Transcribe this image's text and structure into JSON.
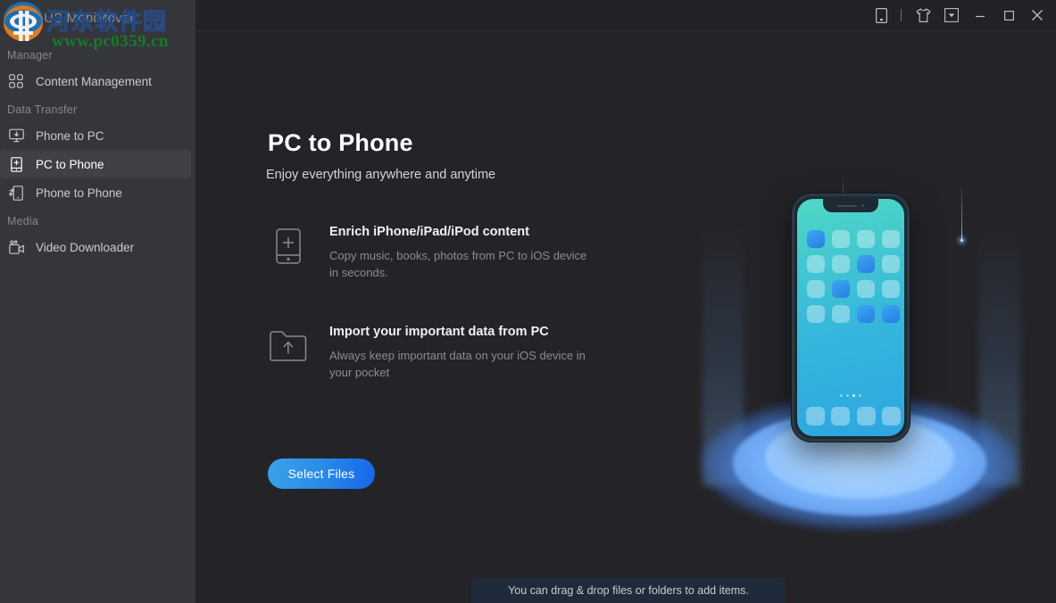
{
  "window": {
    "brand": "EaseUS MobiMover",
    "controls": [
      {
        "name": "device-icon",
        "label": "Device"
      },
      {
        "name": "tshirt-icon",
        "label": "Theme"
      },
      {
        "name": "menu-dropdown-icon",
        "label": "Menu"
      },
      {
        "name": "minimize-icon",
        "label": "Minimize"
      },
      {
        "name": "maximize-icon",
        "label": "Maximize"
      },
      {
        "name": "close-icon",
        "label": "Close"
      }
    ]
  },
  "watermark": {
    "chinese": "河东软件园",
    "url": "www.pc0359.cn"
  },
  "sidebar": {
    "sections": [
      {
        "label": "Manager",
        "items": [
          {
            "label": "Content Management",
            "icon": "grid-icon",
            "active": false
          }
        ]
      },
      {
        "label": "Data Transfer",
        "items": [
          {
            "label": "Phone to PC",
            "icon": "monitor-download-icon",
            "active": false
          },
          {
            "label": "PC to Phone",
            "icon": "phone-plus-icon",
            "active": true
          },
          {
            "label": "Phone to Phone",
            "icon": "phone-transfer-icon",
            "active": false
          }
        ]
      },
      {
        "label": "Media",
        "items": [
          {
            "label": "Video Downloader",
            "icon": "video-camera-icon",
            "active": false
          }
        ]
      }
    ]
  },
  "main": {
    "title": "PC to Phone",
    "subtitle": "Enjoy everything anywhere and anytime",
    "features": [
      {
        "icon": "phone-plus-icon",
        "title": "Enrich iPhone/iPad/iPod content",
        "desc": "Copy music, books, photos from PC to iOS device in seconds."
      },
      {
        "icon": "folder-upload-icon",
        "title": "Import your important data from PC",
        "desc": "Always keep important data on your iOS device in your pocket"
      }
    ],
    "select_files_label": "Select Files",
    "drop_hint": "You can drag & drop files or folders to add items."
  },
  "illustration": {
    "name": "phone-illustration",
    "app_grid": [
      [
        1,
        0,
        0,
        0
      ],
      [
        0,
        0,
        1,
        0
      ],
      [
        0,
        1,
        0,
        0
      ],
      [
        0,
        0,
        1,
        1
      ]
    ],
    "dock_count": 4,
    "page_dots": 4,
    "active_dot_index": 2
  },
  "colors": {
    "accent": "#2b8ee6",
    "accent_deep": "#1765e8",
    "sidebar_bg": "#35363b",
    "content_bg": "#242428",
    "titlebar_bg": "#222226",
    "active_item_bg": "#3f4147",
    "dropbar_bg": "#1f2b3a",
    "screen_top": "#4fd8c4",
    "screen_bottom": "#2da6e0"
  }
}
